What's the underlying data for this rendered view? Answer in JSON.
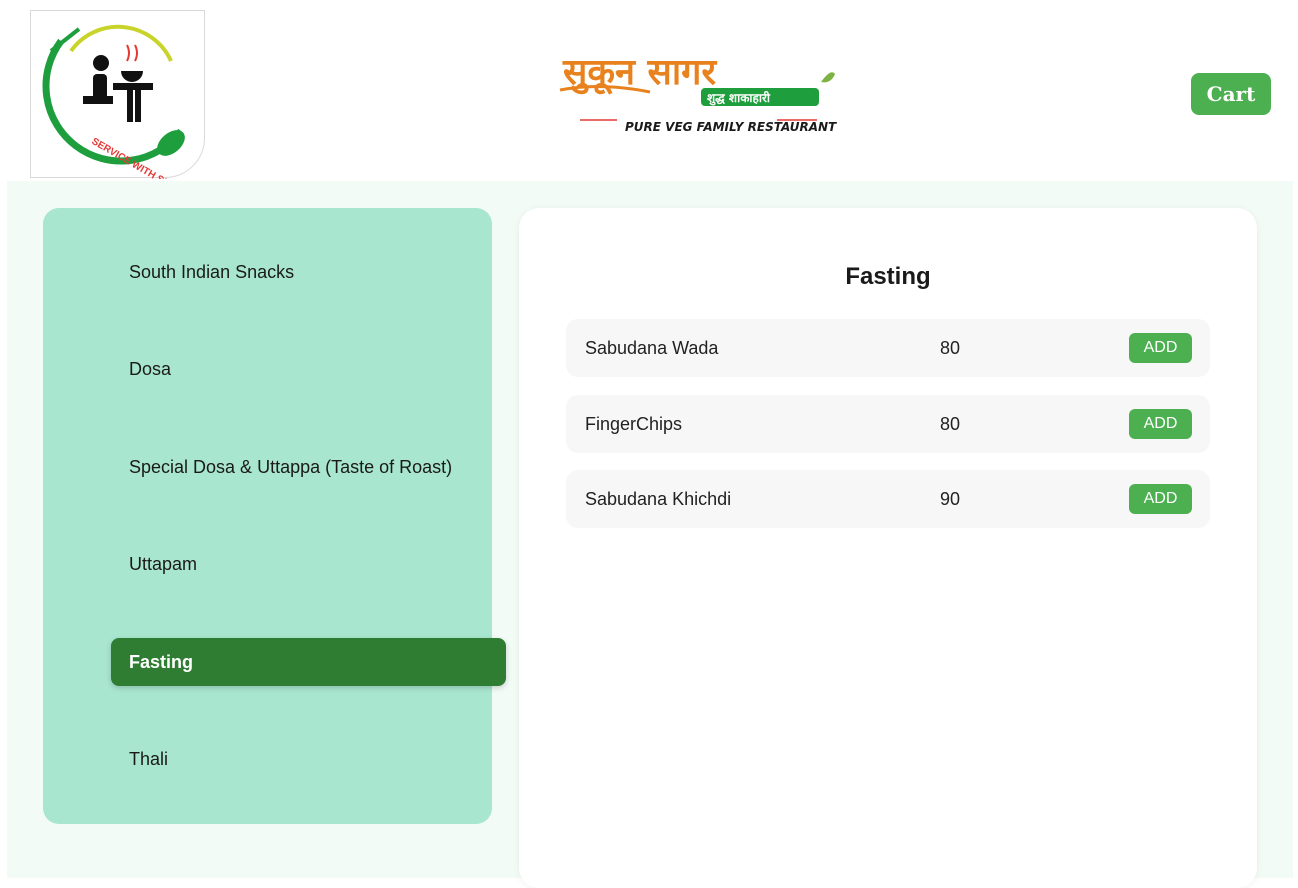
{
  "header": {
    "logo_text": "SERVICE WITH SMILE",
    "brand_name": "सुकून सागर",
    "brand_tag": "शुद्ध शाकाहारी",
    "brand_subtitle": "PURE VEG FAMILY RESTAURANT",
    "cart_label": "Cart"
  },
  "colors": {
    "accent": "#4caf50",
    "active": "#2e7d32",
    "sidebar_bg": "#a8e6cf",
    "brand_orange": "#e8821e"
  },
  "categories": [
    {
      "label": "South Indian Snacks"
    },
    {
      "label": "Dosa"
    },
    {
      "label": "Special Dosa & Uttappa (Taste of Roast)"
    },
    {
      "label": "Uttapam"
    },
    {
      "label": "Fasting",
      "active": true
    },
    {
      "label": "Thali"
    }
  ],
  "menu": {
    "title": "Fasting",
    "add_label": "ADD",
    "items": [
      {
        "name": "Sabudana Wada",
        "price": "80"
      },
      {
        "name": "FingerChips",
        "price": "80"
      },
      {
        "name": "Sabudana Khichdi",
        "price": "90"
      }
    ]
  }
}
